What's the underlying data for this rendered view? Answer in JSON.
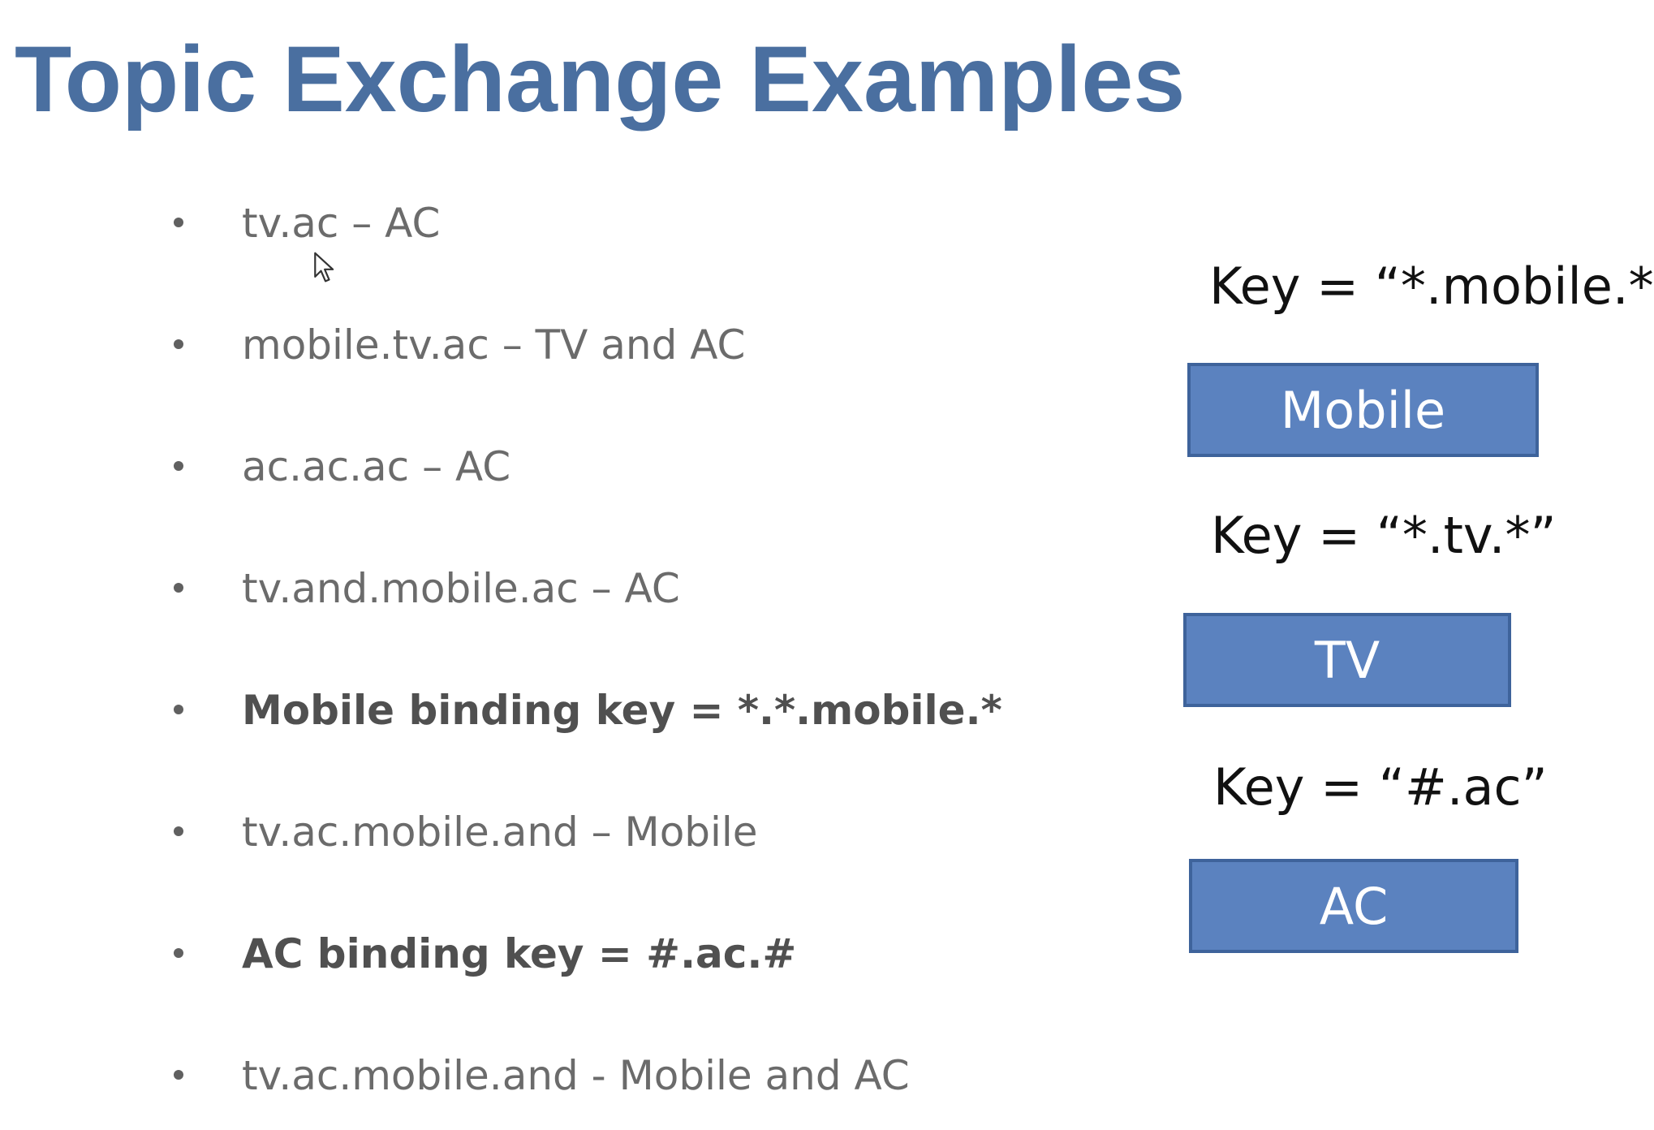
{
  "title": "Topic Exchange Examples",
  "bullets": [
    {
      "text": "tv.ac – AC",
      "bold": false
    },
    {
      "text": "mobile.tv.ac – TV and AC",
      "bold": false
    },
    {
      "text": "ac.ac.ac – AC",
      "bold": false
    },
    {
      "text": "tv.and.mobile.ac – AC",
      "bold": false
    },
    {
      "text": "Mobile binding key = *.*.mobile.*",
      "bold": true
    },
    {
      "text": "tv.ac.mobile.and – Mobile",
      "bold": false
    },
    {
      "text": "AC binding key = #.ac.#",
      "bold": true
    },
    {
      "text": "tv.ac.mobile.and - Mobile and AC",
      "bold": false
    }
  ],
  "queues": [
    {
      "key_label": "Key  =  “*.mobile.*”",
      "box_label": "Mobile"
    },
    {
      "key_label": "Key  =  “*.tv.*”",
      "box_label": "TV"
    },
    {
      "key_label": "Key  =  “#.ac”",
      "box_label": "AC"
    }
  ],
  "colors": {
    "title": "#4a6fa0",
    "box_fill": "#5b82bf",
    "box_border": "#3e639b"
  },
  "icons": {
    "cursor": "mouse-pointer-icon"
  }
}
